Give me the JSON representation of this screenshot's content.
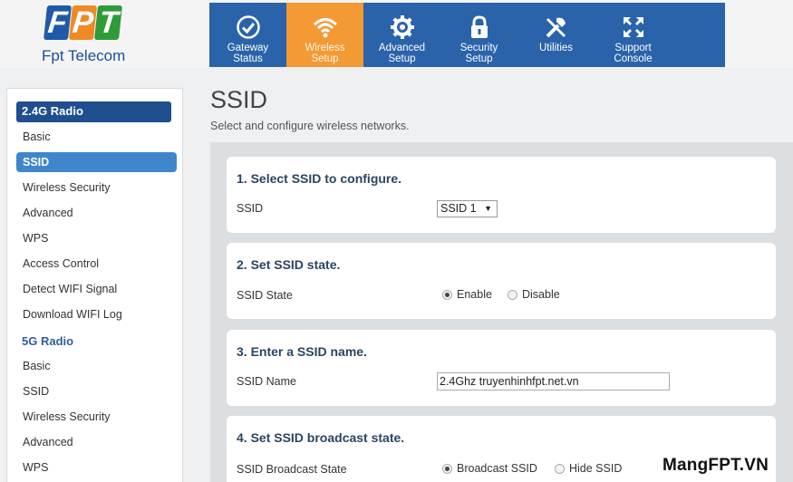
{
  "brand": {
    "letters": [
      "F",
      "P",
      "T"
    ],
    "letter_colors": [
      "#1f5aa8",
      "#f08a24",
      "#2f9a3a"
    ],
    "name": "Fpt Telecom"
  },
  "nav": {
    "items": [
      {
        "line1": "Gateway",
        "line2": "Status",
        "icon": "check-circle-icon"
      },
      {
        "line1": "Wireless",
        "line2": "Setup",
        "icon": "wifi-icon",
        "active": true
      },
      {
        "line1": "Advanced",
        "line2": "Setup",
        "icon": "gear-icon"
      },
      {
        "line1": "Security",
        "line2": "Setup",
        "icon": "lock-icon"
      },
      {
        "line1": "Utilities",
        "line2": "",
        "icon": "tools-icon"
      },
      {
        "line1": "Support",
        "line2": "Console",
        "icon": "arrows-inward-icon"
      }
    ]
  },
  "sidebar": {
    "section_24": "2.4G Radio",
    "items_24": [
      "Basic",
      "SSID",
      "Wireless Security",
      "Advanced",
      "WPS",
      "Access Control",
      "Detect WIFI Signal",
      "Download WIFI Log"
    ],
    "section_5": "5G Radio",
    "items_5": [
      "Basic",
      "SSID",
      "Wireless Security",
      "Advanced",
      "WPS"
    ]
  },
  "page": {
    "title": "SSID",
    "subtitle": "Select and configure wireless networks."
  },
  "panels": {
    "select_ssid": {
      "title": "1. Select SSID to configure.",
      "label": "SSID",
      "value": "SSID 1"
    },
    "ssid_state": {
      "title": "2. Set SSID state.",
      "label": "SSID State",
      "option_enable": "Enable",
      "option_disable": "Disable",
      "selected": "Enable"
    },
    "ssid_name": {
      "title": "3. Enter a SSID name.",
      "label": "SSID Name",
      "value": "2.4Ghz truyenhinhfpt.net.vn"
    },
    "broadcast": {
      "title": "4. Set SSID broadcast state.",
      "label": "SSID Broadcast State",
      "option_broadcast": "Broadcast SSID",
      "option_hide": "Hide SSID",
      "selected": "Broadcast SSID"
    }
  },
  "watermark": "MangFPT.VN",
  "colors": {
    "nav_bg": "#2a63aa",
    "nav_active": "#f39a34",
    "sidebar_section": "#1f4f8f",
    "sidebar_active": "#3f86cc"
  }
}
